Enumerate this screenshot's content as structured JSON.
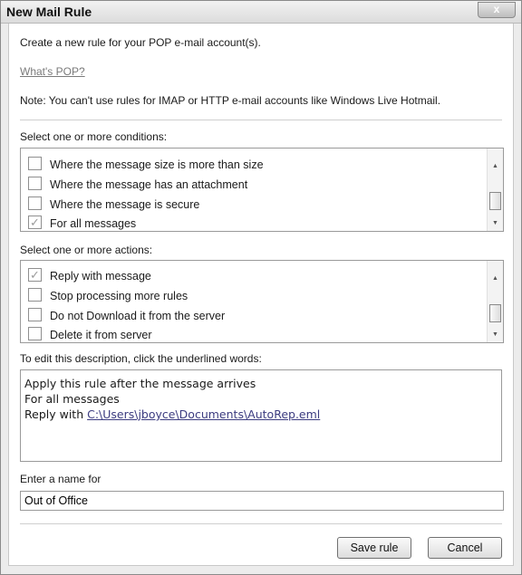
{
  "window": {
    "title": "New Mail Rule",
    "close_label": "x"
  },
  "intro": "Create a new rule for your POP e-mail account(s).",
  "whats_pop_link": "What's POP?",
  "note": "Note: You can't use rules for IMAP or HTTP e-mail accounts like Windows Live Hotmail.",
  "conditions": {
    "label": "Select one or more conditions:",
    "items": [
      {
        "label": "Where the message size is more than size",
        "checked": false
      },
      {
        "label": "Where the message has an attachment",
        "checked": false
      },
      {
        "label": "Where the message is secure",
        "checked": false
      },
      {
        "label": "For all messages",
        "checked": true
      }
    ]
  },
  "actions": {
    "label": "Select one or more actions:",
    "items": [
      {
        "label": "Reply with message",
        "checked": true
      },
      {
        "label": "Stop processing more rules",
        "checked": false
      },
      {
        "label": "Do not Download it from the server",
        "checked": false
      },
      {
        "label": "Delete it from server",
        "checked": false
      }
    ]
  },
  "description": {
    "label": "To edit this description, click the underlined words:",
    "line1": "Apply this rule after the message arrives",
    "line2": "For all messages",
    "line3_prefix": "Reply with ",
    "line3_link": "C:\\Users\\jboyce\\Documents\\AutoRep.eml"
  },
  "name_field": {
    "label": "Enter a name for",
    "value": "Out of Office"
  },
  "buttons": {
    "save": "Save rule",
    "cancel": "Cancel"
  }
}
